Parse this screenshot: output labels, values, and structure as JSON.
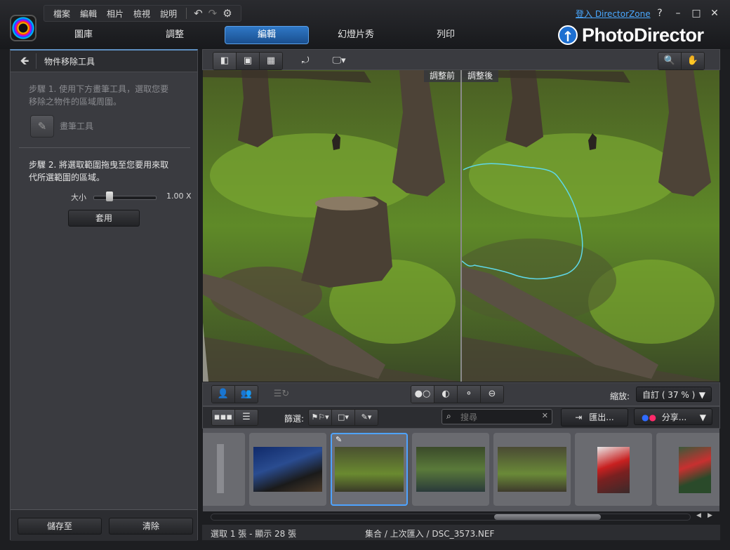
{
  "menu": {
    "items": [
      "檔案",
      "編輯",
      "相片",
      "檢視",
      "說明"
    ],
    "undo_icon": "undo-icon",
    "redo_icon": "redo-icon",
    "settings_icon": "gear-icon"
  },
  "modes": {
    "tabs": [
      "圖庫",
      "調整",
      "編輯",
      "幻燈片秀",
      "列印"
    ],
    "active": "編輯"
  },
  "brand": {
    "name": "PhotoDirector",
    "login_link": "登入 DirectorZone"
  },
  "window_controls": [
    "?",
    "–",
    "□",
    "✕"
  ],
  "left_panel": {
    "title": "物件移除工具",
    "step1": "步驟 1. 使用下方畫筆工具，選取您要移除之物件的區域周圍。",
    "step1_line1": "步驟 1. 使用下方畫筆工具，選取您要",
    "step1_line2": "移除之物件的區域周圍。",
    "brush_label": "畫筆工具",
    "step2_line1": "步驟 2. 將選取範圍拖曳至您要用來取",
    "step2_line2": "代所選範圍的區域。",
    "size_label": "大小",
    "size_value": "1.00 X",
    "size_fraction": 0.2,
    "apply_button": "套用",
    "save_button": "儲存至",
    "clear_button": "清除"
  },
  "viewer": {
    "before_label": "調整前",
    "after_label": "調整後",
    "selection_color": "#5fd8e8"
  },
  "bottom_toolbar": {
    "zoom_label": "縮放:",
    "zoom_value": "自訂 ( 37 % )"
  },
  "film_toolbar": {
    "filter_label": "篩選:",
    "search_placeholder": "搜尋",
    "export_button": "匯出...",
    "share_button": "分享..."
  },
  "status": {
    "left": "選取 1 張 - 顯示 28 張",
    "center": "集合 / 上次匯入 / DSC_3573.NEF"
  },
  "colors": {
    "accent": "#4ea3ff",
    "active_tab": "#2f78c6"
  }
}
